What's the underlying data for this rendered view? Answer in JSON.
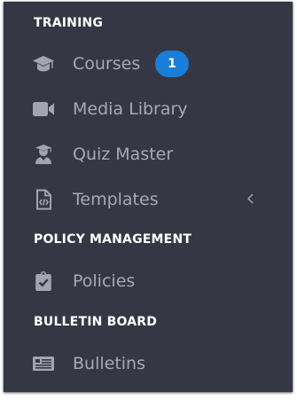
{
  "sections": {
    "training": {
      "title": "TRAINING",
      "items": [
        {
          "label": "Courses",
          "icon": "graduation-cap-icon",
          "badge": "1"
        },
        {
          "label": "Media Library",
          "icon": "video-camera-icon"
        },
        {
          "label": "Quiz Master",
          "icon": "user-graduate-icon"
        },
        {
          "label": "Templates",
          "icon": "code-file-icon",
          "expand_icon": "chevron-left-icon"
        }
      ]
    },
    "policy_management": {
      "title": "POLICY MANAGEMENT",
      "items": [
        {
          "label": "Policies",
          "icon": "clipboard-check-icon"
        }
      ]
    },
    "bulletin_board": {
      "title": "BULLETIN BOARD",
      "items": [
        {
          "label": "Bulletins",
          "icon": "newspaper-icon"
        }
      ]
    }
  },
  "colors": {
    "sidebar_background": "#353744",
    "section_header_text": "#ffffff",
    "item_text": "#a7aab6",
    "badge_background": "#1a7ed8"
  }
}
